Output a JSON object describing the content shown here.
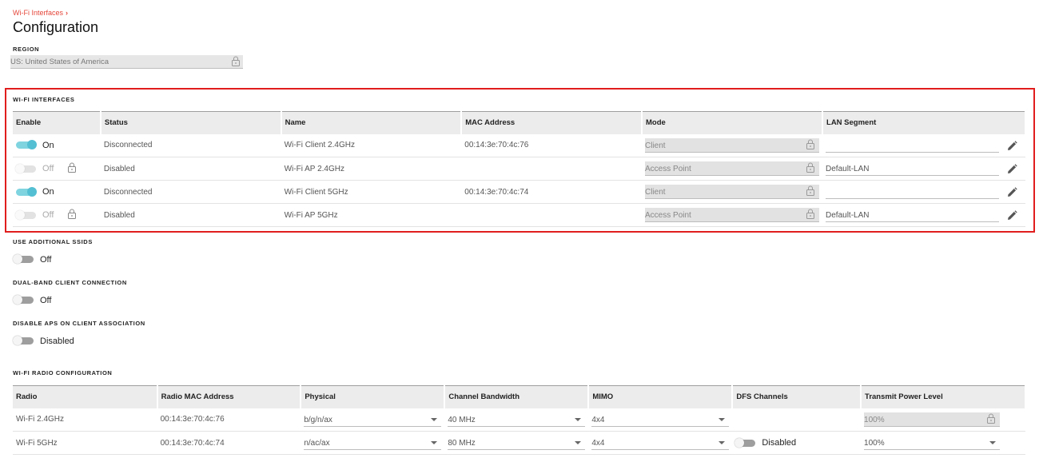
{
  "breadcrumb": {
    "label": "Wi-Fi Interfaces",
    "chevron": "›"
  },
  "page_title": "Configuration",
  "region": {
    "label": "REGION",
    "value": "US: United States of America"
  },
  "wifi_interfaces": {
    "label": "WI-FI INTERFACES",
    "columns": [
      "Enable",
      "Status",
      "Name",
      "MAC Address",
      "Mode",
      "LAN Segment"
    ],
    "rows": [
      {
        "enabled": true,
        "enable_text": "On",
        "status": "Disconnected",
        "name": "Wi-Fi Client 2.4GHz",
        "mac": "00:14:3e:70:4c:76",
        "mode": "Client",
        "lan": ""
      },
      {
        "enabled": false,
        "enable_text": "Off",
        "status": "Disabled",
        "name": "Wi-Fi AP 2.4GHz",
        "mac": "",
        "mode": "Access Point",
        "lan": "Default-LAN"
      },
      {
        "enabled": true,
        "enable_text": "On",
        "status": "Disconnected",
        "name": "Wi-Fi Client 5GHz",
        "mac": "00:14:3e:70:4c:74",
        "mode": "Client",
        "lan": ""
      },
      {
        "enabled": false,
        "enable_text": "Off",
        "status": "Disabled",
        "name": "Wi-Fi AP 5GHz",
        "mac": "",
        "mode": "Access Point",
        "lan": "Default-LAN"
      }
    ]
  },
  "additional_ssids": {
    "label": "USE ADDITIONAL SSIDS",
    "value": "Off"
  },
  "dual_band": {
    "label": "DUAL-BAND CLIENT CONNECTION",
    "value": "Off"
  },
  "disable_aps": {
    "label": "DISABLE APS ON CLIENT ASSOCIATION",
    "value": "Disabled"
  },
  "radio_config": {
    "label": "WI-FI RADIO CONFIGURATION",
    "columns": [
      "Radio",
      "Radio MAC Address",
      "Physical",
      "Channel Bandwidth",
      "MIMO",
      "DFS Channels",
      "Transmit Power Level"
    ],
    "rows": [
      {
        "radio": "Wi-Fi 2.4GHz",
        "mac": "00:14:3e:70:4c:76",
        "physical": "b/g/n/ax",
        "bandwidth": "40 MHz",
        "mimo": "4x4",
        "dfs": "",
        "power": "100%"
      },
      {
        "radio": "Wi-Fi 5GHz",
        "mac": "00:14:3e:70:4c:74",
        "physical": "n/ac/ax",
        "bandwidth": "80 MHz",
        "mimo": "4x4",
        "dfs": "Disabled",
        "power": "100%"
      }
    ]
  },
  "icons": {
    "lock": "lock-icon",
    "edit": "pencil-icon",
    "caret": "caret-down-icon"
  },
  "colors": {
    "accent": "#54bfd2",
    "breadcrumb": "#e5473b",
    "highlight": "#e11d1d"
  }
}
